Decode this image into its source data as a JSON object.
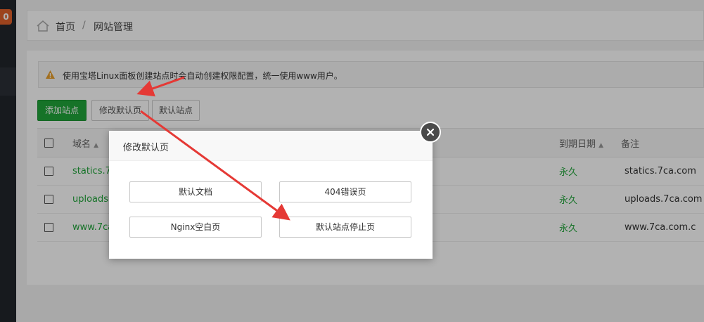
{
  "sidebar": {
    "badge": "0"
  },
  "breadcrumb": {
    "home": "首页",
    "separator": "/",
    "current": "网站管理"
  },
  "notice": {
    "text": "使用宝塔Linux面板创建站点时会自动创建权限配置，统一使用www用户。"
  },
  "toolbar": {
    "add_site": "添加站点",
    "modify_default": "修改默认页",
    "default_site": "默认站点"
  },
  "table": {
    "headers": {
      "domain": "域名",
      "expire": "到期日期",
      "remark": "备注"
    },
    "rows": [
      {
        "domain": "statics.7ca.",
        "expire": "永久",
        "remark": "statics.7ca.com"
      },
      {
        "domain": "uploads.7c",
        "expire": "永久",
        "remark": "uploads.7ca.com"
      },
      {
        "domain": "www.7ca.c",
        "expire": "永久",
        "remark": "www.7ca.com.c"
      }
    ]
  },
  "modal": {
    "title": "修改默认页",
    "options": {
      "default_doc": "默认文档",
      "error_404": "404错误页",
      "nginx_blank": "Nginx空白页",
      "site_stopped": "默认站点停止页"
    }
  },
  "colors": {
    "accent_green": "#20a53a",
    "annotation_arrow": "#e53935",
    "badge": "#e0612a"
  }
}
